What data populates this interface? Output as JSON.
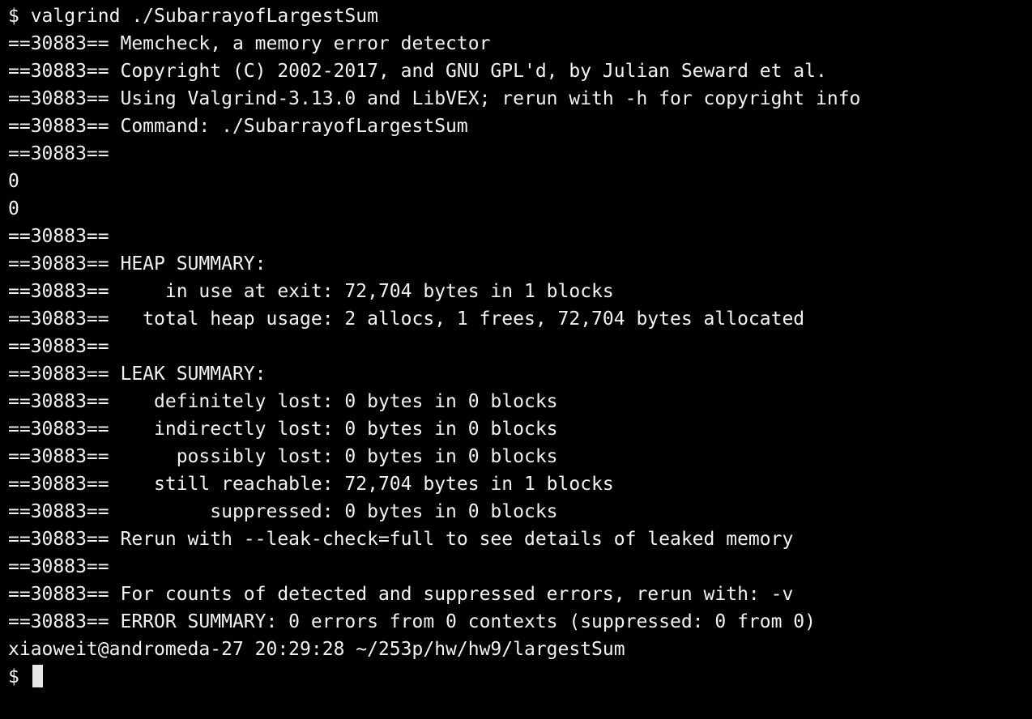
{
  "terminal": {
    "lines": [
      "$ valgrind ./SubarrayofLargestSum",
      "==30883== Memcheck, a memory error detector",
      "==30883== Copyright (C) 2002-2017, and GNU GPL'd, by Julian Seward et al.",
      "==30883== Using Valgrind-3.13.0 and LibVEX; rerun with -h for copyright info",
      "==30883== Command: ./SubarrayofLargestSum",
      "==30883==",
      "0",
      "0",
      "==30883==",
      "==30883== HEAP SUMMARY:",
      "==30883==     in use at exit: 72,704 bytes in 1 blocks",
      "==30883==   total heap usage: 2 allocs, 1 frees, 72,704 bytes allocated",
      "==30883==",
      "==30883== LEAK SUMMARY:",
      "==30883==    definitely lost: 0 bytes in 0 blocks",
      "==30883==    indirectly lost: 0 bytes in 0 blocks",
      "==30883==      possibly lost: 0 bytes in 0 blocks",
      "==30883==    still reachable: 72,704 bytes in 1 blocks",
      "==30883==         suppressed: 0 bytes in 0 blocks",
      "==30883== Rerun with --leak-check=full to see details of leaked memory",
      "==30883==",
      "==30883== For counts of detected and suppressed errors, rerun with: -v",
      "==30883== ERROR SUMMARY: 0 errors from 0 contexts (suppressed: 0 from 0)",
      "xiaoweit@andromeda-27 20:29:28 ~/253p/hw/hw9/largestSum"
    ],
    "prompt": "$ "
  }
}
